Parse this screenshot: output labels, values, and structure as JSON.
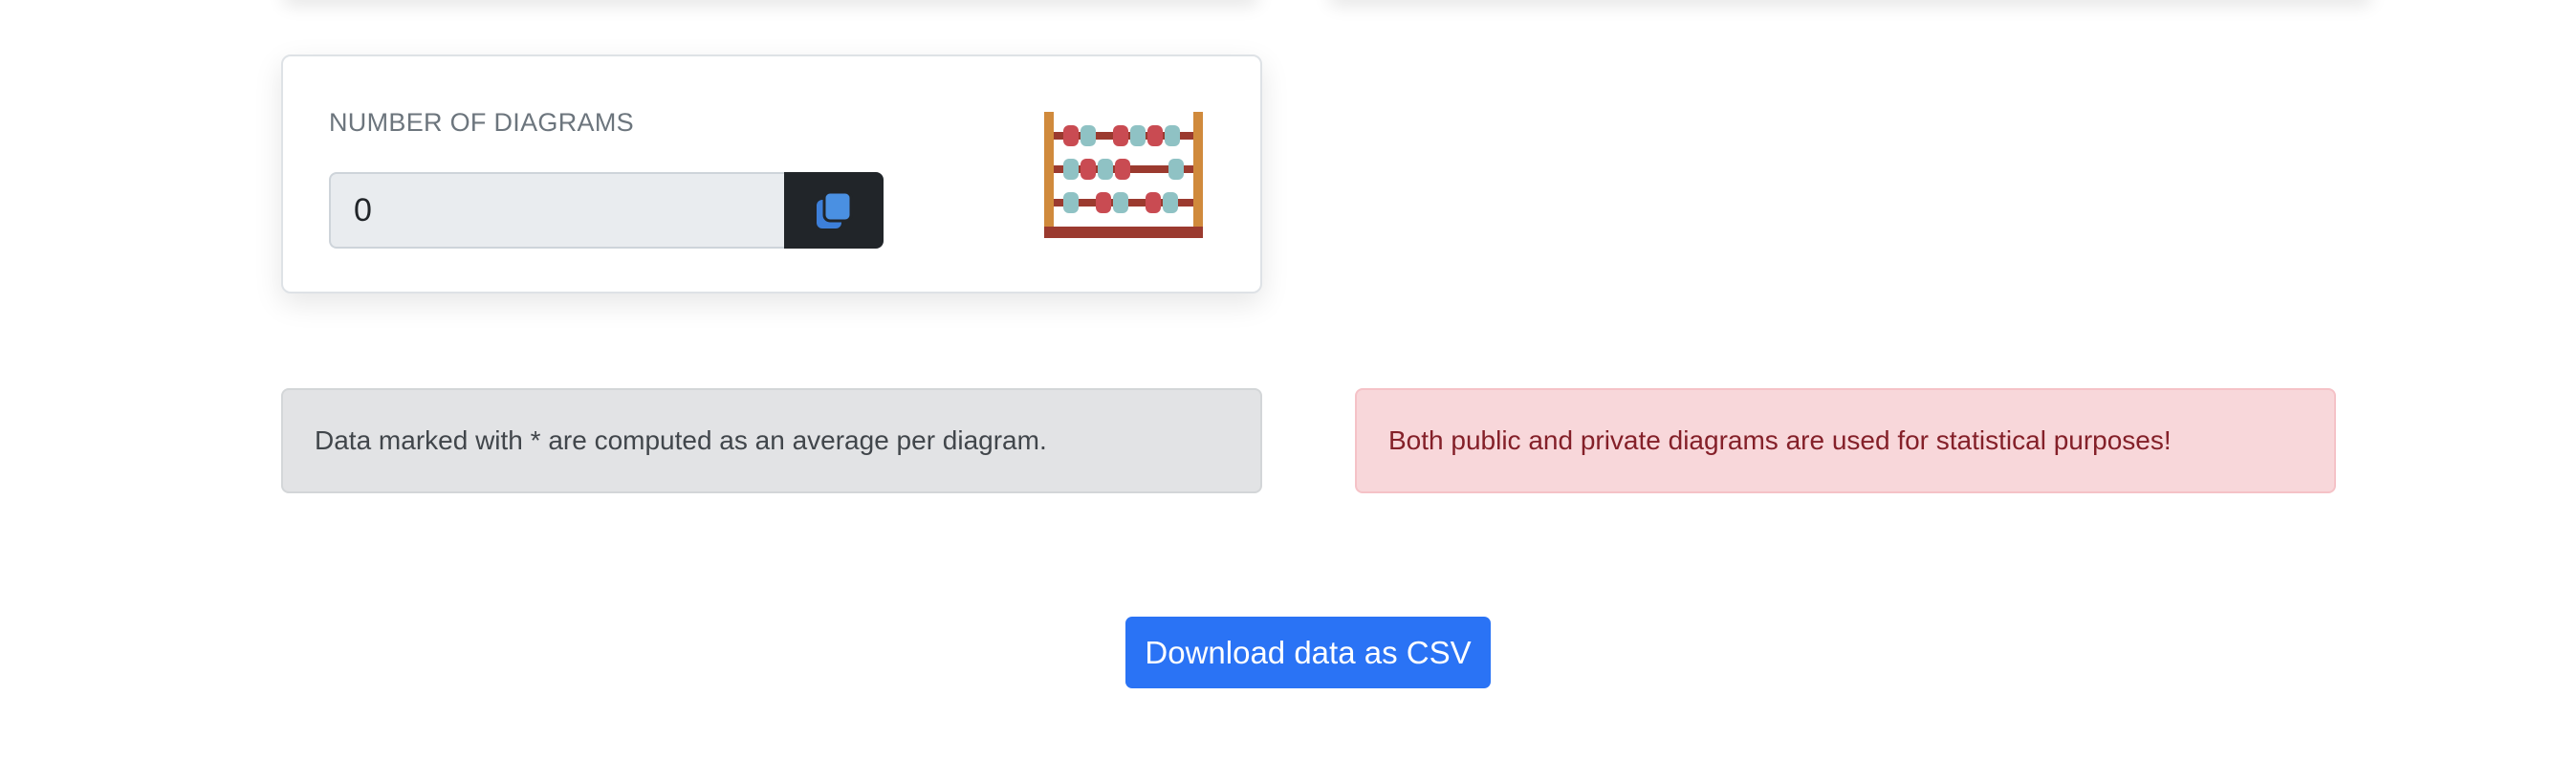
{
  "stat_card": {
    "label": "NUMBER OF DIAGRAMS",
    "value": "0",
    "copy_icon": "copy-icon",
    "illustration_icon": "abacus-icon"
  },
  "alerts": {
    "info": "Data marked with * are computed as an average per diagram.",
    "warning": "Both public and private diagrams are used for statistical purposes!"
  },
  "actions": {
    "download_label": "Download data as CSV"
  },
  "colors": {
    "primary": "#2a73f5",
    "dark": "#212529",
    "secondary_bg": "#e2e3e5",
    "danger_bg": "#f8d7da",
    "danger_text": "#842029"
  }
}
